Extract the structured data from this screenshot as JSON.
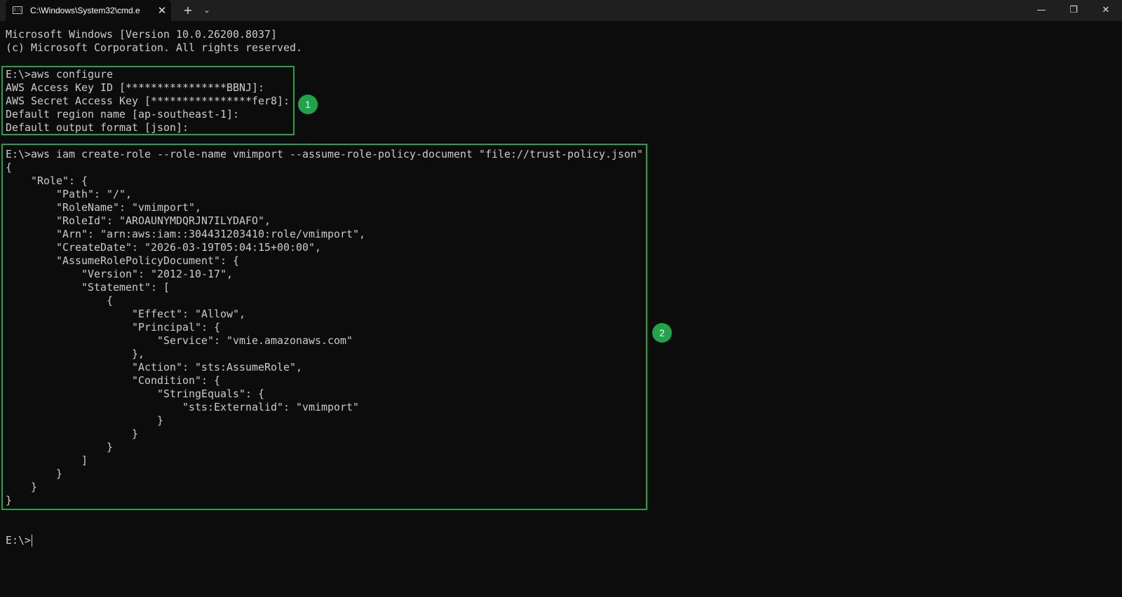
{
  "window": {
    "tab_title": "C:\\Windows\\System32\\cmd.e",
    "tab_icon_text": "C:\\",
    "tab_close_glyph": "✕",
    "new_tab_glyph": "+",
    "dropdown_glyph": "⌄",
    "minimize_glyph": "—",
    "maximize_glyph": "❐",
    "close_glyph": "✕"
  },
  "terminal": {
    "lines": [
      "Microsoft Windows [Version 10.0.26200.8037]",
      "(c) Microsoft Corporation. All rights reserved.",
      "",
      "E:\\>aws configure",
      "AWS Access Key ID [****************BBNJ]:",
      "AWS Secret Access Key [****************fer8]:",
      "Default region name [ap-southeast-1]:",
      "Default output format [json]:",
      "",
      "E:\\>aws iam create-role --role-name vmimport --assume-role-policy-document \"file://trust-policy.json\"",
      "{",
      "    \"Role\": {",
      "        \"Path\": \"/\",",
      "        \"RoleName\": \"vmimport\",",
      "        \"RoleId\": \"AROAUNYMDQRJN7ILYDAFO\",",
      "        \"Arn\": \"arn:aws:iam::304431203410:role/vmimport\",",
      "        \"CreateDate\": \"2026-03-19T05:04:15+00:00\",",
      "        \"AssumeRolePolicyDocument\": {",
      "            \"Version\": \"2012-10-17\",",
      "            \"Statement\": [",
      "                {",
      "                    \"Effect\": \"Allow\",",
      "                    \"Principal\": {",
      "                        \"Service\": \"vmie.amazonaws.com\"",
      "                    },",
      "                    \"Action\": \"sts:AssumeRole\",",
      "                    \"Condition\": {",
      "                        \"StringEquals\": {",
      "                            \"sts:Externalid\": \"vmimport\"",
      "                        }",
      "                    }",
      "                }",
      "            ]",
      "        }",
      "    }",
      "}",
      "",
      "",
      "E:\\>"
    ]
  },
  "annotations": [
    {
      "label": "1",
      "color": "#22a34a"
    },
    {
      "label": "2",
      "color": "#22a34a"
    }
  ]
}
